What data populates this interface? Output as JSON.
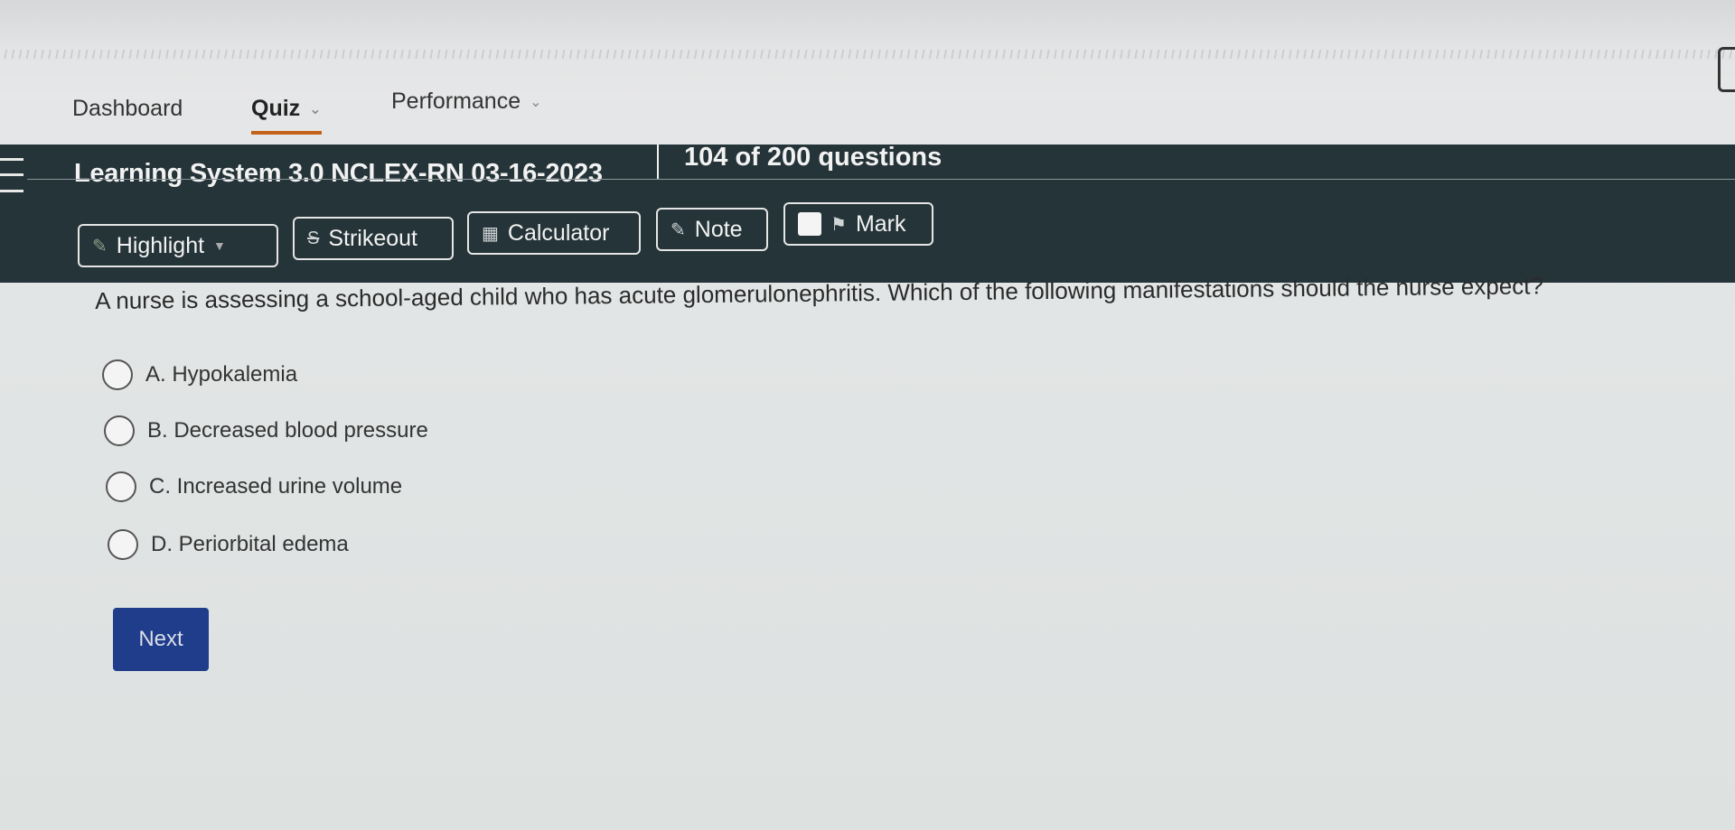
{
  "nav": {
    "dashboard": "Dashboard",
    "quiz": "Quiz",
    "performance": "Performance"
  },
  "header": {
    "title": "Learning System 3.0 NCLEX-RN 03-16-2023",
    "progress": "104 of 200 questions"
  },
  "toolbar": {
    "highlight": "Highlight",
    "strikeout": "Strikeout",
    "calculator": "Calculator",
    "note": "Note",
    "mark": "Mark"
  },
  "question": {
    "text": "A nurse is assessing a school-aged child who has acute glomerulonephritis. Which of the following manifestations should the nurse expect?",
    "options": [
      {
        "label": "A. Hypokalemia"
      },
      {
        "label": "B. Decreased blood pressure"
      },
      {
        "label": "C. Increased urine volume"
      },
      {
        "label": "D. Periorbital edema"
      }
    ]
  },
  "actions": {
    "next": "Next"
  },
  "colors": {
    "header_bg": "#253438",
    "accent_underline": "#c4621a",
    "next_button": "#1f3d8a"
  }
}
